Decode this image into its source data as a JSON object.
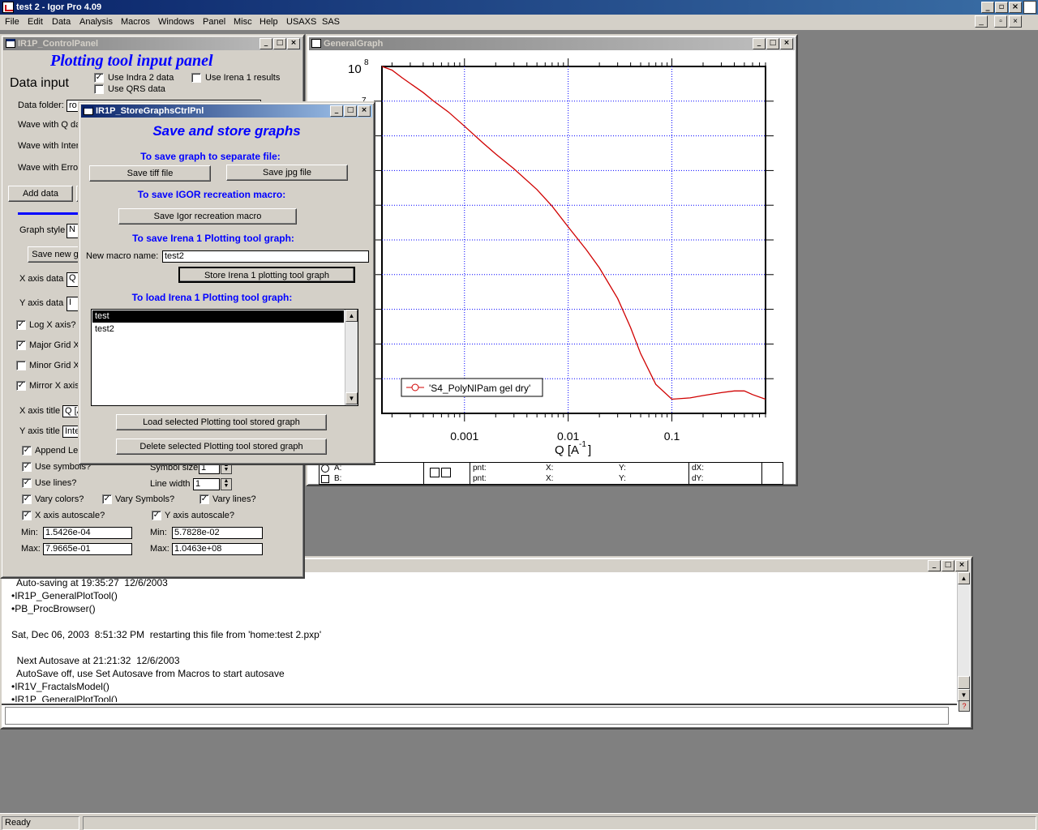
{
  "app": {
    "title": "test 2 - Igor Pro 4.09"
  },
  "menu": [
    "File",
    "Edit",
    "Data",
    "Analysis",
    "Macros",
    "Windows",
    "Panel",
    "Misc",
    "Help",
    "USAXS",
    "SAS"
  ],
  "control_panel": {
    "window_title": "IR1P_ControlPanel",
    "heading": "Plotting tool input panel",
    "data_input_label": "Data input",
    "use_indra2": "Use Indra 2 data",
    "use_qrs": "Use QRS data",
    "use_irena1": "Use Irena 1 results",
    "data_folder_label": "Data folder:",
    "data_folder_value": "ro",
    "wave_q_label": "Wave with Q da",
    "wave_int_label": "Wave with Inter",
    "wave_err_label": "Wave with Erro",
    "add_data": "Add data",
    "graph_style_label": "Graph style",
    "graph_style_value": "N",
    "save_new": "Save new g",
    "x_axis_data_label": "X axis data",
    "x_axis_data_value": "Q",
    "y_axis_data_label": "Y axis data",
    "y_axis_data_value": "I",
    "log_x": "Log X axis?",
    "major_grid_x": "Major Grid X a",
    "minor_grid_x": "Minor Grid X a",
    "mirror_x": "Mirror X axis?",
    "x_axis_title_label": "X axis title",
    "x_axis_title_value": "Q [A",
    "y_axis_title_label": "Y axis title",
    "y_axis_title_value": "Inte",
    "append_legend": "Append Leg",
    "use_symbols": "Use symbols?",
    "symbol_size_label": "Symbol size",
    "symbol_size_value": "1",
    "use_lines": "Use lines?",
    "line_width_label": "Line width",
    "line_width_value": "1",
    "vary_colors": "Vary colors?",
    "vary_symbols": "Vary Symbols?",
    "vary_lines": "Vary lines?",
    "x_autoscale": "X axis autoscale?",
    "y_autoscale": "Y axis autoscale?",
    "min_label": "Min:",
    "max_label": "Max:",
    "x_min": "1.5426e-04",
    "x_max": "7.9665e-01",
    "y_min": "5.7828e-02",
    "y_max": "1.0463e+08",
    "checked_mark": "✓"
  },
  "store_panel": {
    "window_title": "IR1P_StoreGraphsCtrlPnl",
    "heading": "Save and store graphs",
    "sep_file_head": "To save graph to separate file:",
    "save_tiff": "Save tiff file",
    "save_jpg": "Save jpg file",
    "igor_macro_head": "To save IGOR recreation macro:",
    "save_igor_macro": "Save Igor recreation macro",
    "irena_save_head": "To save Irena 1 Plotting tool graph:",
    "new_macro_label": "New macro name:",
    "new_macro_value": "test2",
    "store_button": "Store Irena 1 plotting tool graph",
    "irena_load_head": "To load Irena 1 Plotting tool graph:",
    "list_items": [
      "test",
      "test2"
    ],
    "load_button": "Load selected Plotting tool stored graph",
    "delete_button": "Delete selected Plotting tool stored graph"
  },
  "graph_window": {
    "window_title": "GeneralGraph",
    "cursor_a": "A:",
    "cursor_b": "B:",
    "pnt": "pnt:",
    "x": "X:",
    "y": "Y:",
    "dx": "dX:",
    "dy": "dY:"
  },
  "chart_data": {
    "type": "line",
    "xscale": "log",
    "yscale": "log",
    "xlabel_base": "Q [A",
    "xlabel_exp": "-1",
    "xlabel_close": "]",
    "x_ticklabels": [
      "0.001",
      "0.01",
      "0.1"
    ],
    "y_ticklabel_top_base": "10",
    "y_ticklabel_top_exp": "8",
    "y_ticklabel_second": "7",
    "legend": "'S4_PolyNIPam gel dry'",
    "legend_position": "bottom-left",
    "grid": "dotted blue",
    "series_color": "#d00000",
    "xlim": [
      0.00016,
      0.8
    ],
    "ylim": [
      0.05,
      100000000
    ],
    "series": [
      {
        "name": "'S4_PolyNIPam gel dry'",
        "x": [
          0.00016,
          0.0002,
          0.00025,
          0.0003,
          0.0004,
          0.0005,
          0.0007,
          0.001,
          0.0015,
          0.002,
          0.003,
          0.005,
          0.007,
          0.01,
          0.015,
          0.02,
          0.03,
          0.04,
          0.05,
          0.07,
          0.1,
          0.15,
          0.2,
          0.3,
          0.4,
          0.5,
          0.6,
          0.8
        ],
        "y": [
          100000000,
          80000000,
          50000000,
          35000000,
          20000000,
          12000000,
          6000000,
          2500000,
          900000,
          450000,
          180000,
          50000,
          18000,
          5000,
          1200,
          400,
          60,
          10,
          2,
          0.3,
          0.12,
          0.13,
          0.15,
          0.18,
          0.2,
          0.2,
          0.16,
          0.12
        ]
      }
    ]
  },
  "command_window": {
    "lines": [
      "  Auto-saving at 19:35:27  12/6/2003",
      "•IR1P_GeneralPlotTool()",
      "•PB_ProcBrowser()",
      "",
      "Sat, Dec 06, 2003  8:51:32 PM  restarting this file from 'home:test 2.pxp'",
      "",
      "  Next Autosave at 21:21:32  12/6/2003",
      "  AutoSave off, use Set Autosave from Macros to start autosave",
      "•IR1V_FractalsModel()",
      "•IR1P_GeneralPlotTool()"
    ]
  },
  "status": {
    "text": "Ready"
  }
}
